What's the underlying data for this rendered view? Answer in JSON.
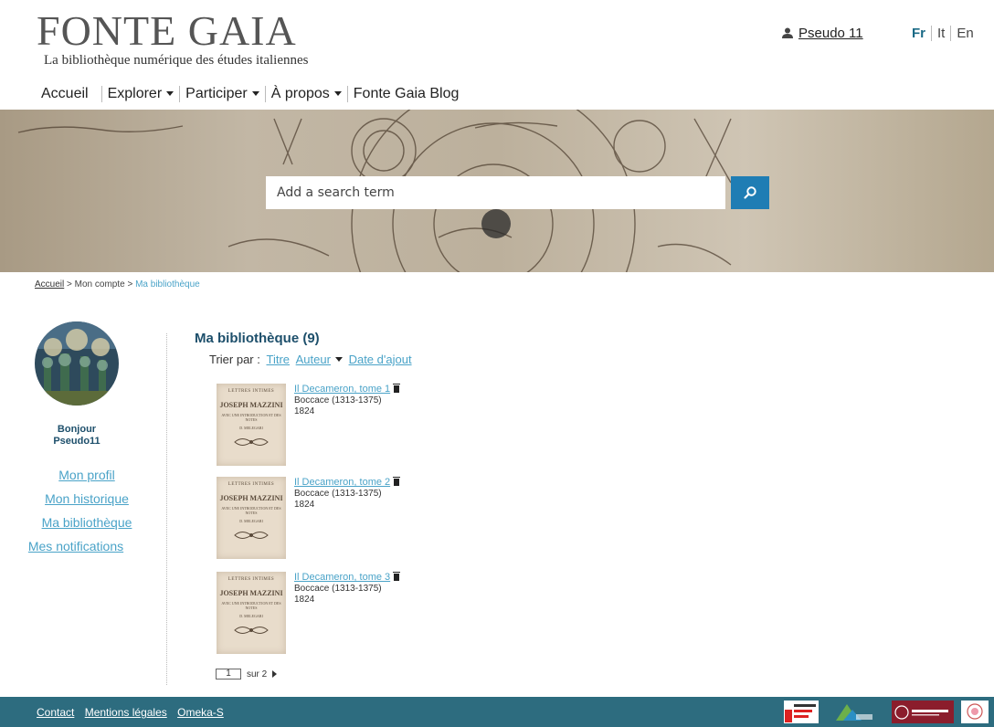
{
  "header": {
    "logo_title": "FONTE GAIA",
    "logo_subtitle": "La bibliothèque numérique des études italiennes",
    "user_name": "Pseudo 11",
    "languages": [
      "Fr",
      "It",
      "En"
    ]
  },
  "nav": {
    "items": [
      {
        "label": "Accueil",
        "dropdown": false
      },
      {
        "label": "Explorer",
        "dropdown": true
      },
      {
        "label": "Participer",
        "dropdown": true
      },
      {
        "label": "À propos",
        "dropdown": true
      },
      {
        "label": "Fonte Gaia Blog",
        "dropdown": false
      }
    ]
  },
  "banner": {
    "search_placeholder": "Add a search term"
  },
  "breadcrumb": {
    "home": "Accueil",
    "sep": ">",
    "middle": "Mon compte",
    "current": "Ma bibliothèque"
  },
  "sidebar": {
    "greeting": "Bonjour",
    "username": "Pseudo11",
    "links": [
      "Mon profil",
      "Mon historique",
      "Ma bibliothèque",
      "Mes notifications"
    ]
  },
  "library": {
    "title": "Ma bibliothèque (9)",
    "sort_label": "Trier par :",
    "sort_options": [
      "Titre",
      "Auteur",
      "Date d'ajout"
    ],
    "books": [
      {
        "title": "Il Decameron, tome 1",
        "author": "Boccace (1313-1375)",
        "year": "1824"
      },
      {
        "title": "Il Decameron, tome 2",
        "author": "Boccace (1313-1375)",
        "year": "1824"
      },
      {
        "title": "Il Decameron, tome 3",
        "author": "Boccace (1313-1375)",
        "year": "1824"
      }
    ],
    "cover_text": {
      "line1": "LETTRES INTIMES",
      "line2": "JOSEPH MAZZINI",
      "line3": "AVEC UNE INTRODUCTION ET DES NOTES",
      "line4": "D. MELEGARI"
    },
    "pager": {
      "current": "1",
      "total_label": "sur 2"
    }
  },
  "footer": {
    "links": [
      "Contact",
      "Mentions légales",
      "Omeka-S"
    ],
    "logos": [
      "Université Grenoble Alpes",
      "msh",
      "Sapienza Università di Roma",
      "partner-seal"
    ]
  },
  "colors": {
    "accent": "#4aa3c8",
    "heading": "#1d4f6b",
    "search_button": "#1f7db4",
    "footer": "#2d6c7f"
  }
}
